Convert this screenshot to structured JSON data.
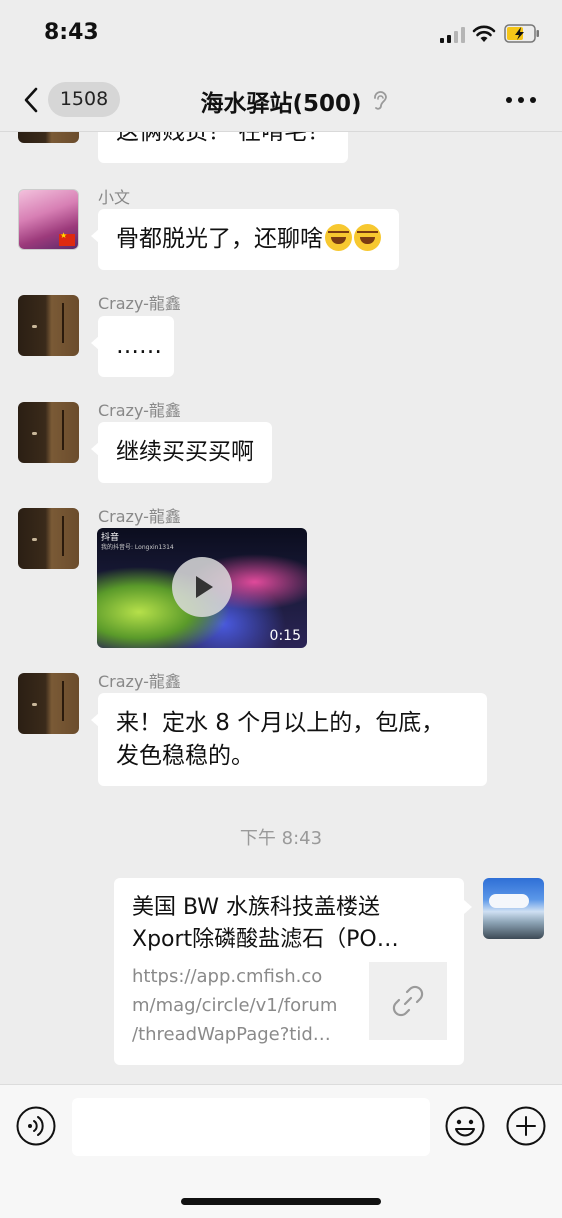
{
  "status_bar": {
    "time": "8:43"
  },
  "nav": {
    "unread_count": "1508",
    "title": "海水驿站(500)"
  },
  "messages": [
    {
      "sender": "",
      "text": "这俩贱货？ 在啃宅？"
    },
    {
      "sender": "小文",
      "text": "骨都脱光了，还聊啥",
      "emoji": [
        "rolling-on-floor-laughing-emoji",
        "rolling-on-floor-laughing-emoji"
      ]
    },
    {
      "sender": "Crazy-龍鑫",
      "text": "……"
    },
    {
      "sender": "Crazy-龍鑫",
      "text": "继续买买买啊"
    },
    {
      "sender": "Crazy-龍鑫",
      "video": {
        "source_label": "抖音",
        "source_sub": "我的抖音号: Longxin1314",
        "duration": "0:15"
      }
    },
    {
      "sender": "Crazy-龍鑫",
      "line1": "来！定水 8 个月以上的，包底，",
      "line2": "发色稳稳的。"
    }
  ],
  "timestamp": "下午 8:43",
  "link_card": {
    "title_line1": "美国 BW 水族科技盖楼送",
    "title_line2": "Xport除磷酸盐滤石（PO…",
    "url_line1": "https://app.cmfish.co",
    "url_line2": "m/mag/circle/v1/forum",
    "url_line3": "/threadWapPage?tid…",
    "thumb_icon": "link-icon"
  },
  "input_bar": {
    "placeholder": "",
    "voice_icon": "voice-icon",
    "emoji_icon": "smiley-icon",
    "plus_icon": "plus-icon"
  },
  "colors": {
    "background": "#ededed",
    "bubble": "#ffffff",
    "secondary_text": "#888888"
  }
}
